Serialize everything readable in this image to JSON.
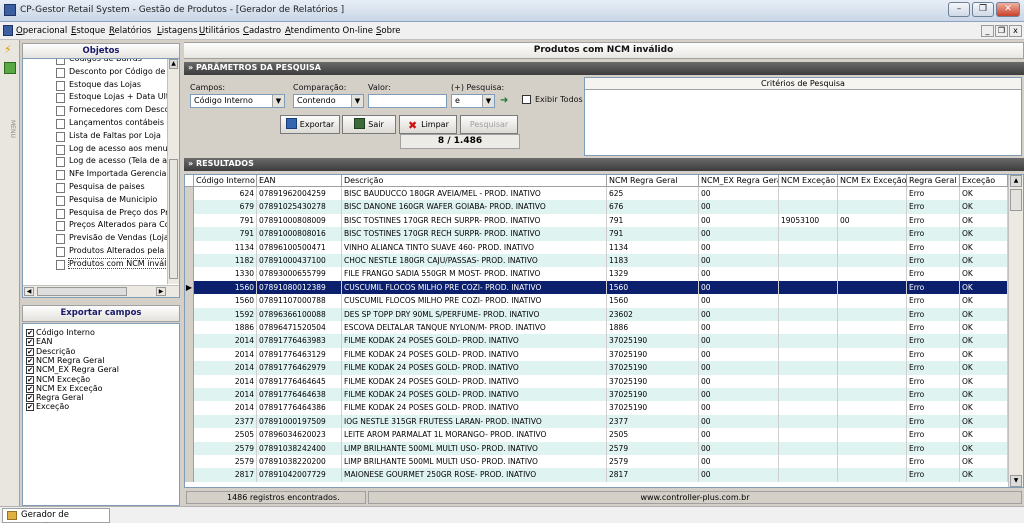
{
  "window": {
    "title": "CP-Gestor Retail System - Gestão de Produtos - [Gerador de Relatórios ]"
  },
  "menu": [
    "Operacional",
    "Estoque",
    "Relatórios",
    "Listagens",
    "Utilitários",
    "Cadastro",
    "Atendimento On-line",
    "Sobre"
  ],
  "left_panel": {
    "objects_title": "Objetos",
    "objects": [
      "Códigos de Barras",
      "Desconto por Código de Bar",
      "Estoque das Lojas",
      "Estoque Lojas + Data Ultima",
      "Fornecedores com Desconto",
      "Lançamentos contábeis retr",
      "Lista de Faltas por Loja",
      "Log de acesso aos menus",
      "Log de acesso (Tela de atua",
      "NFe Importada Gerenciamer",
      "Pesquisa de paises",
      "Pesquisa de Municipio",
      "Pesquisa de Preço dos Prod",
      "Preços Alterados para Conf",
      "Previsão de Vendas (Loja - l",
      "Produtos Alterados pela MG",
      "Produtos com NCM inválido"
    ],
    "export_title": "Exportar campos",
    "export_fields": [
      "Código Interno",
      "EAN",
      "Descrição",
      "NCM Regra Geral",
      "NCM_EX Regra Geral",
      "NCM Exceção",
      "NCM Ex Exceção",
      "Regra Geral",
      "Exceção"
    ]
  },
  "main": {
    "title": "Produtos com NCM inválido",
    "params_header": "» PARÂMETROS DA PESQUISA",
    "campos_label": "Campos:",
    "campos_value": "Código Interno",
    "comparacao_label": "Comparação:",
    "comparacao_value": "Contendo",
    "valor_label": "Valor:",
    "valor_value": "",
    "pesquisa_label": "(+) Pesquisa:",
    "pesquisa_value": "e",
    "exibir_todos": "Exibir Todos",
    "exportar": "Exportar",
    "sair": "Sair",
    "limpar": "Limpar",
    "pesquisar": "Pesquisar",
    "counter": "8 / 1.486",
    "criteria_header": "Critérios de Pesquisa",
    "results_header": "» RESULTADOS"
  },
  "grid": {
    "columns": [
      "Código Interno",
      "EAN",
      "Descrição",
      "NCM Regra Geral",
      "NCM_EX Regra Geral",
      "NCM Exceção",
      "NCM Ex Exceção",
      "Regra Geral",
      "Exceção"
    ],
    "rows": [
      [
        "624",
        "07891962004259",
        "BISC BAUDUCCO 180GR AVEIA/MEL - PROD. INATIVO",
        "625",
        "00",
        "",
        "",
        "Erro",
        "OK"
      ],
      [
        "679",
        "07891025430278",
        "BISC DANONE 160GR WAFER GOIABA- PROD. INATIVO",
        "676",
        "00",
        "",
        "",
        "Erro",
        "OK"
      ],
      [
        "791",
        "07891000808009",
        "BISC TOSTINES 170GR RECH SURPR- PROD. INATIVO",
        "791",
        "00",
        "19053100",
        "00",
        "Erro",
        "OK"
      ],
      [
        "791",
        "07891000808016",
        "BISC TOSTINES 170GR RECH SURPR- PROD. INATIVO",
        "791",
        "00",
        "",
        "",
        "Erro",
        "OK"
      ],
      [
        "1134",
        "07896100500471",
        "VINHO  ALIANCA TINTO SUAVE 460- PROD. INATIVO",
        "1134",
        "00",
        "",
        "",
        "Erro",
        "OK"
      ],
      [
        "1182",
        "07891000437100",
        "CHOC NESTLE 180GR CAJU/PASSAS- PROD. INATIVO",
        "1183",
        "00",
        "",
        "",
        "Erro",
        "OK"
      ],
      [
        "1330",
        "07893000655799",
        "FILE FRANGO SADIA 550GR M MOST- PROD. INATIVO",
        "1329",
        "00",
        "",
        "",
        "Erro",
        "OK"
      ],
      [
        "1560",
        "07891080012389",
        "CUSCUMIL FLOCOS MILHO PRE COZI- PROD. INATIVO",
        "1560",
        "00",
        "",
        "",
        "Erro",
        "OK"
      ],
      [
        "1560",
        "07891107000788",
        "CUSCUMIL FLOCOS MILHO PRE COZI- PROD. INATIVO",
        "1560",
        "00",
        "",
        "",
        "Erro",
        "OK"
      ],
      [
        "1592",
        "07896366100088",
        "DES SP TOPP DRY 90ML S/PERFUME- PROD. INATIVO",
        "23602",
        "00",
        "",
        "",
        "Erro",
        "OK"
      ],
      [
        "1886",
        "07896471520504",
        "ESCOVA DELTALAR TANQUE NYLON/M- PROD. INATIVO",
        "1886",
        "00",
        "",
        "",
        "Erro",
        "OK"
      ],
      [
        "2014",
        "07891776463983",
        "FILME KODAK 24 POSES GOLD- PROD. INATIVO",
        "37025190",
        "00",
        "",
        "",
        "Erro",
        "OK"
      ],
      [
        "2014",
        "07891776463129",
        "FILME KODAK 24 POSES GOLD- PROD. INATIVO",
        "37025190",
        "00",
        "",
        "",
        "Erro",
        "OK"
      ],
      [
        "2014",
        "07891776462979",
        "FILME KODAK 24 POSES GOLD- PROD. INATIVO",
        "37025190",
        "00",
        "",
        "",
        "Erro",
        "OK"
      ],
      [
        "2014",
        "07891776464645",
        "FILME KODAK 24 POSES GOLD- PROD. INATIVO",
        "37025190",
        "00",
        "",
        "",
        "Erro",
        "OK"
      ],
      [
        "2014",
        "07891776464638",
        "FILME KODAK 24 POSES GOLD- PROD. INATIVO",
        "37025190",
        "00",
        "",
        "",
        "Erro",
        "OK"
      ],
      [
        "2014",
        "07891776464386",
        "FILME KODAK 24 POSES GOLD- PROD. INATIVO",
        "37025190",
        "00",
        "",
        "",
        "Erro",
        "OK"
      ],
      [
        "2377",
        "07891000197509",
        "IOG NESTLE 315GR FRUTESS LARAN- PROD. INATIVO",
        "2377",
        "00",
        "",
        "",
        "Erro",
        "OK"
      ],
      [
        "2505",
        "07896034620023",
        "LEITE AROM PARMALAT 1L MORANGO- PROD. INATIVO",
        "2505",
        "00",
        "",
        "",
        "Erro",
        "OK"
      ],
      [
        "2579",
        "07891038242400",
        "LIMP BRILHANTE 500ML MULTI USO- PROD. INATIVO",
        "2579",
        "00",
        "",
        "",
        "Erro",
        "OK"
      ],
      [
        "2579",
        "07891038220200",
        "LIMP BRILHANTE 500ML MULTI USO- PROD. INATIVO",
        "2579",
        "00",
        "",
        "",
        "Erro",
        "OK"
      ],
      [
        "2817",
        "07891042007729",
        "MAIONESE GOURMET 250GR ROSE- PROD. INATIVO",
        "2817",
        "00",
        "",
        "",
        "Erro",
        "OK"
      ]
    ]
  },
  "status": {
    "records": "1486 registros encontrados.",
    "site": "www.controller-plus.com.br"
  },
  "taskbar": {
    "item": "Gerador de Relatórios"
  }
}
